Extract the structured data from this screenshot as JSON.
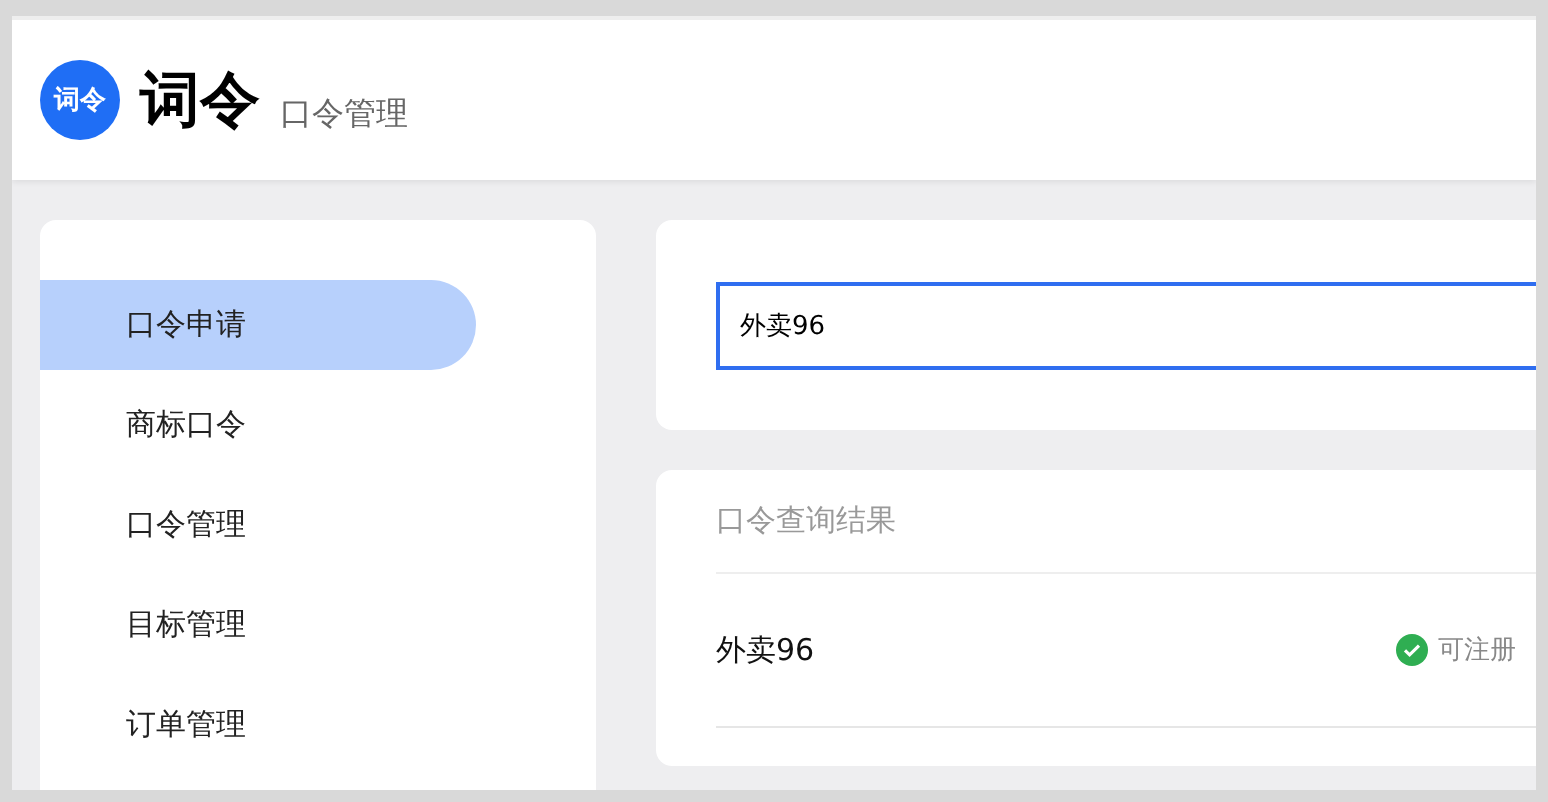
{
  "header": {
    "logo_text": "词令",
    "title": "词令",
    "subtitle": "口令管理"
  },
  "sidebar": {
    "items": [
      {
        "label": "口令申请",
        "selected": true
      },
      {
        "label": "商标口令",
        "selected": false
      },
      {
        "label": "口令管理",
        "selected": false
      },
      {
        "label": "目标管理",
        "selected": false
      },
      {
        "label": "订单管理",
        "selected": false
      }
    ]
  },
  "search": {
    "value": "外卖96"
  },
  "results": {
    "title": "口令查询结果",
    "rows": [
      {
        "name": "外卖96",
        "status": "可注册",
        "available": true
      }
    ]
  }
}
